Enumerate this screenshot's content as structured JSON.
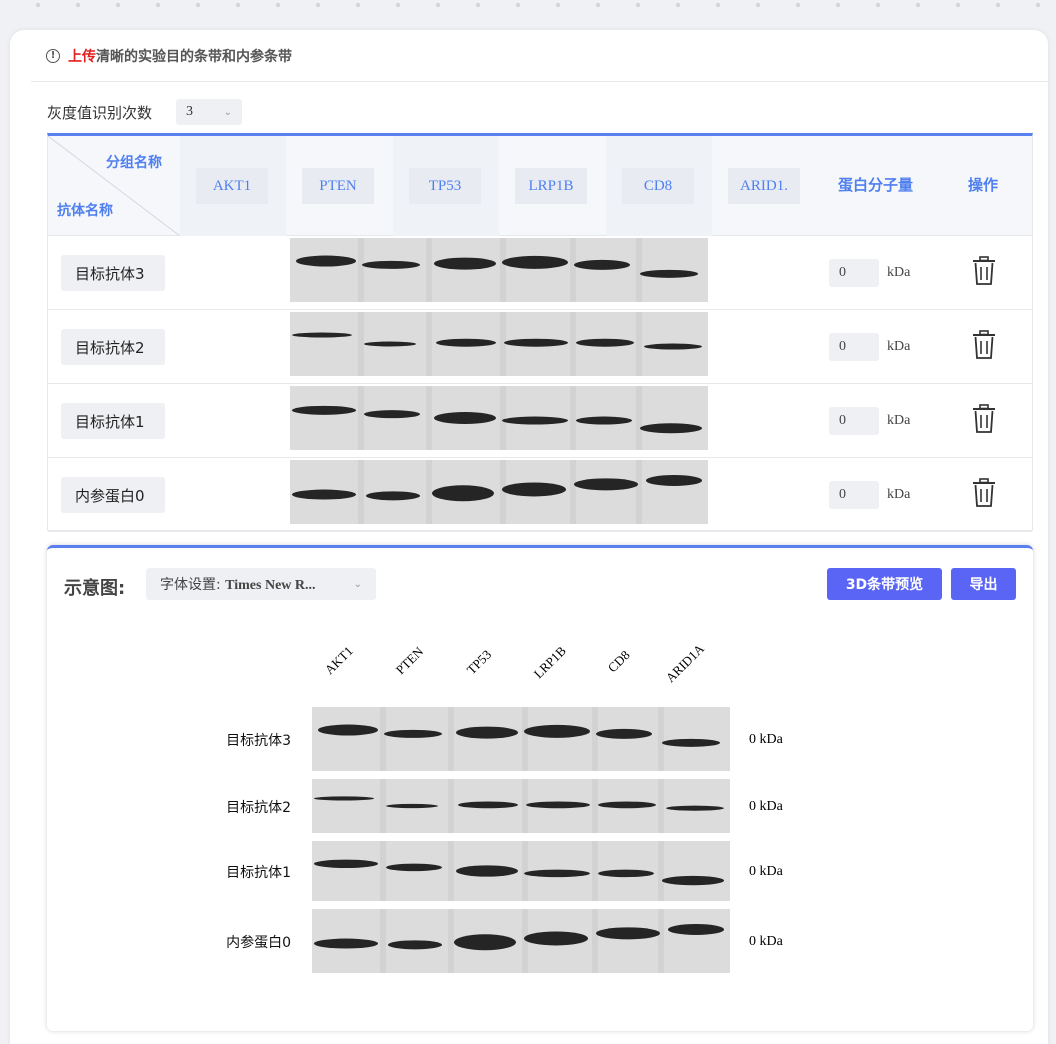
{
  "notice": {
    "icon": "info-icon",
    "highlight": "上传",
    "text": "清晰的实验目的条带和内参条带"
  },
  "gray_recognition": {
    "label": "灰度值识别次数",
    "value": "3"
  },
  "table": {
    "corner_top": "分组名称",
    "corner_bottom": "抗体名称",
    "groups": [
      "AKT1",
      "PTEN",
      "TP53",
      "LRP1B",
      "CD8",
      "ARID1."
    ],
    "col_weight": "蛋白分子量",
    "col_action": "操作",
    "rows": [
      {
        "label": "目标抗体3",
        "kda_value": "0",
        "unit": "kDa"
      },
      {
        "label": "目标抗体2",
        "kda_value": "0",
        "unit": "kDa"
      },
      {
        "label": "目标抗体1",
        "kda_value": "0",
        "unit": "kDa"
      },
      {
        "label": "内参蛋白0",
        "kda_value": "0",
        "unit": "kDa"
      }
    ]
  },
  "preview": {
    "title": "示意图:",
    "font_select": {
      "label": "字体设置:",
      "value": "Times New R..."
    },
    "btn_3d": "3D条带预览",
    "btn_export": "导出",
    "lanes": [
      "AKT1",
      "PTEN",
      "TP53",
      "LRP1B",
      "CD8",
      "ARID1A"
    ],
    "rows": [
      {
        "label": "目标抗体3",
        "kda": "0 kDa"
      },
      {
        "label": "目标抗体2",
        "kda": "0 kDa"
      },
      {
        "label": "目标抗体1",
        "kda": "0 kDa"
      },
      {
        "label": "内参蛋白0",
        "kda": "0 kDa"
      }
    ]
  },
  "colors": {
    "accent": "#5a7ff0",
    "header_text": "#4f7ff0",
    "button": "#5b65f5",
    "highlight": "#e0201f"
  }
}
